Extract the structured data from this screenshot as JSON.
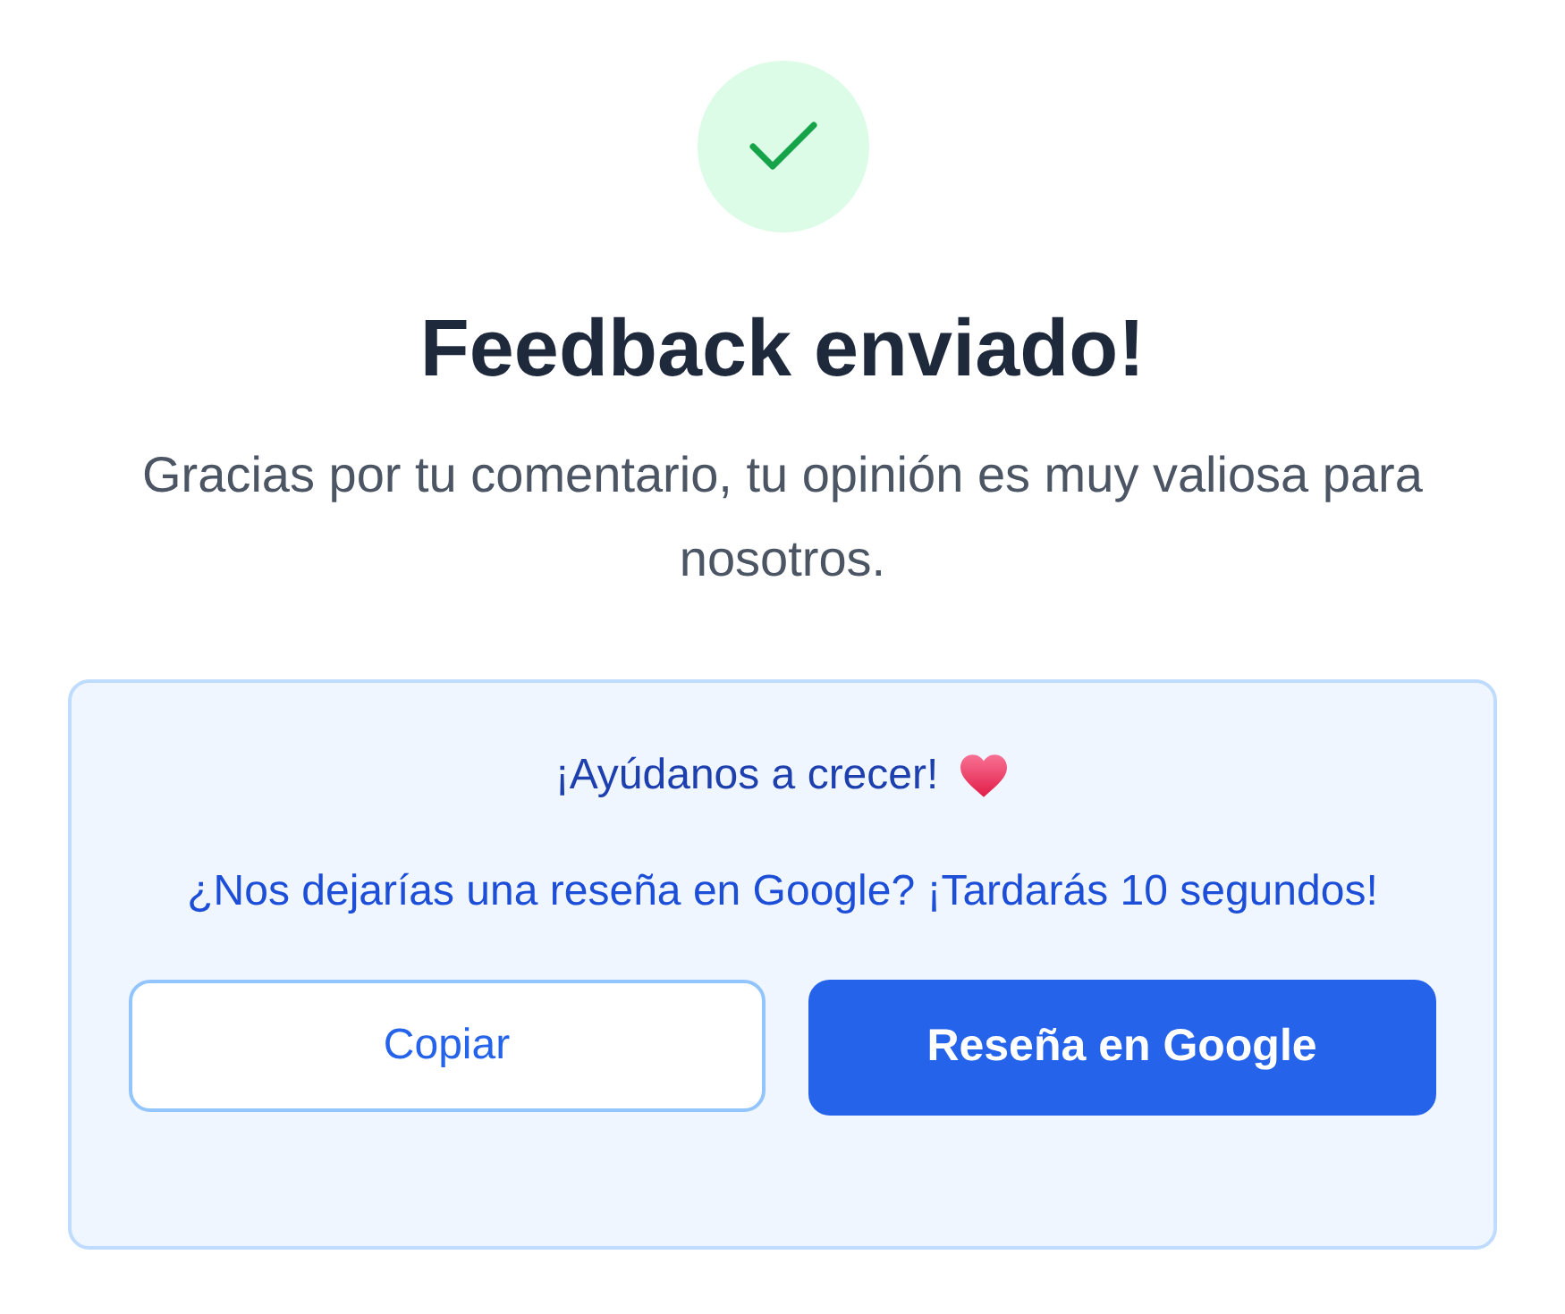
{
  "status": {
    "kind": "success"
  },
  "title": "Feedback enviado!",
  "message": "Gracias por tu comentario, tu opinión es muy valiosa para nosotros.",
  "review_card": {
    "heading": "¡Ayúdanos a crecer!",
    "text": "¿Nos dejarías una reseña en Google? ¡Tardarás 10 segundos!",
    "buttons": [
      {
        "label": "Copiar",
        "kind": "secondary"
      },
      {
        "label": "Reseña en Google",
        "kind": "primary"
      }
    ]
  }
}
